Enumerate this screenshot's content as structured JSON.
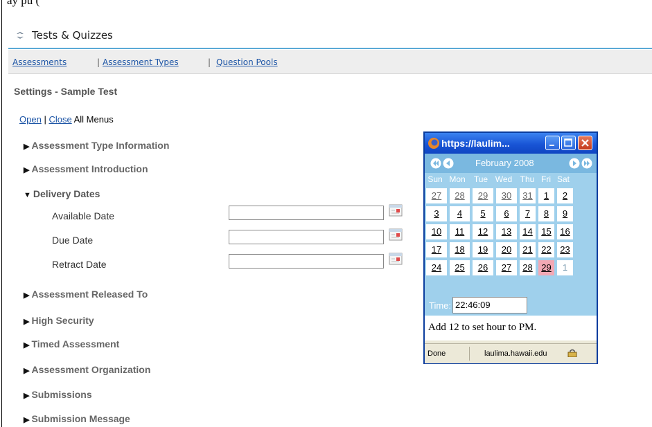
{
  "top_cut_text": "ay                                                              pu (",
  "tool": {
    "title": "Tests & Quizzes",
    "icon": "refresh-arrows-icon"
  },
  "nav": {
    "assessments": "Assessments",
    "assessment_types": "Assessment Types",
    "question_pools": "Question Pools",
    "separator": "|"
  },
  "page_title": "Settings - Sample Test",
  "menus": {
    "open": "Open",
    "sep": "|",
    "close": "Close",
    "suffix": "All Menus"
  },
  "sections": [
    {
      "label": "Assessment Type Information",
      "expanded": false
    },
    {
      "label": "Assessment Introduction",
      "expanded": false
    },
    {
      "label": "Delivery Dates",
      "expanded": true
    },
    {
      "label": "Assessment Released To",
      "expanded": false
    },
    {
      "label": "High Security",
      "expanded": false
    },
    {
      "label": "Timed Assessment",
      "expanded": false
    },
    {
      "label": "Assessment Organization",
      "expanded": false
    },
    {
      "label": "Submissions",
      "expanded": false
    },
    {
      "label": "Submission Message",
      "expanded": false
    }
  ],
  "delivery_dates": {
    "available": {
      "label": "Available Date",
      "value": ""
    },
    "due": {
      "label": "Due Date",
      "value": ""
    },
    "retract": {
      "label": "Retract Date",
      "value": ""
    }
  },
  "popup": {
    "title": "https://laulim...",
    "month": "February 2008",
    "dow": [
      "Sun",
      "Mon",
      "Tue",
      "Wed",
      "Thu",
      "Fri",
      "Sat"
    ],
    "weeks": [
      [
        "27",
        "28",
        "29",
        "30",
        "31",
        "1",
        "2"
      ],
      [
        "3",
        "4",
        "5",
        "6",
        "7",
        "8",
        "9"
      ],
      [
        "10",
        "11",
        "12",
        "13",
        "14",
        "15",
        "16"
      ],
      [
        "17",
        "18",
        "19",
        "20",
        "21",
        "22",
        "23"
      ],
      [
        "24",
        "25",
        "26",
        "27",
        "28",
        "29",
        "1"
      ]
    ],
    "time_label": "Time:",
    "time_value": "22:46:09",
    "hint": "Add 12 to set hour to PM.",
    "status_left": "Done",
    "status_host": "laulima.hawaii.edu"
  },
  "colors": {
    "link": "#1d55a6",
    "accent": "#5aa9d6",
    "calendar_bg": "#9fd0ec",
    "today": "#f2a8b4",
    "titlebar": "#1955d6"
  }
}
